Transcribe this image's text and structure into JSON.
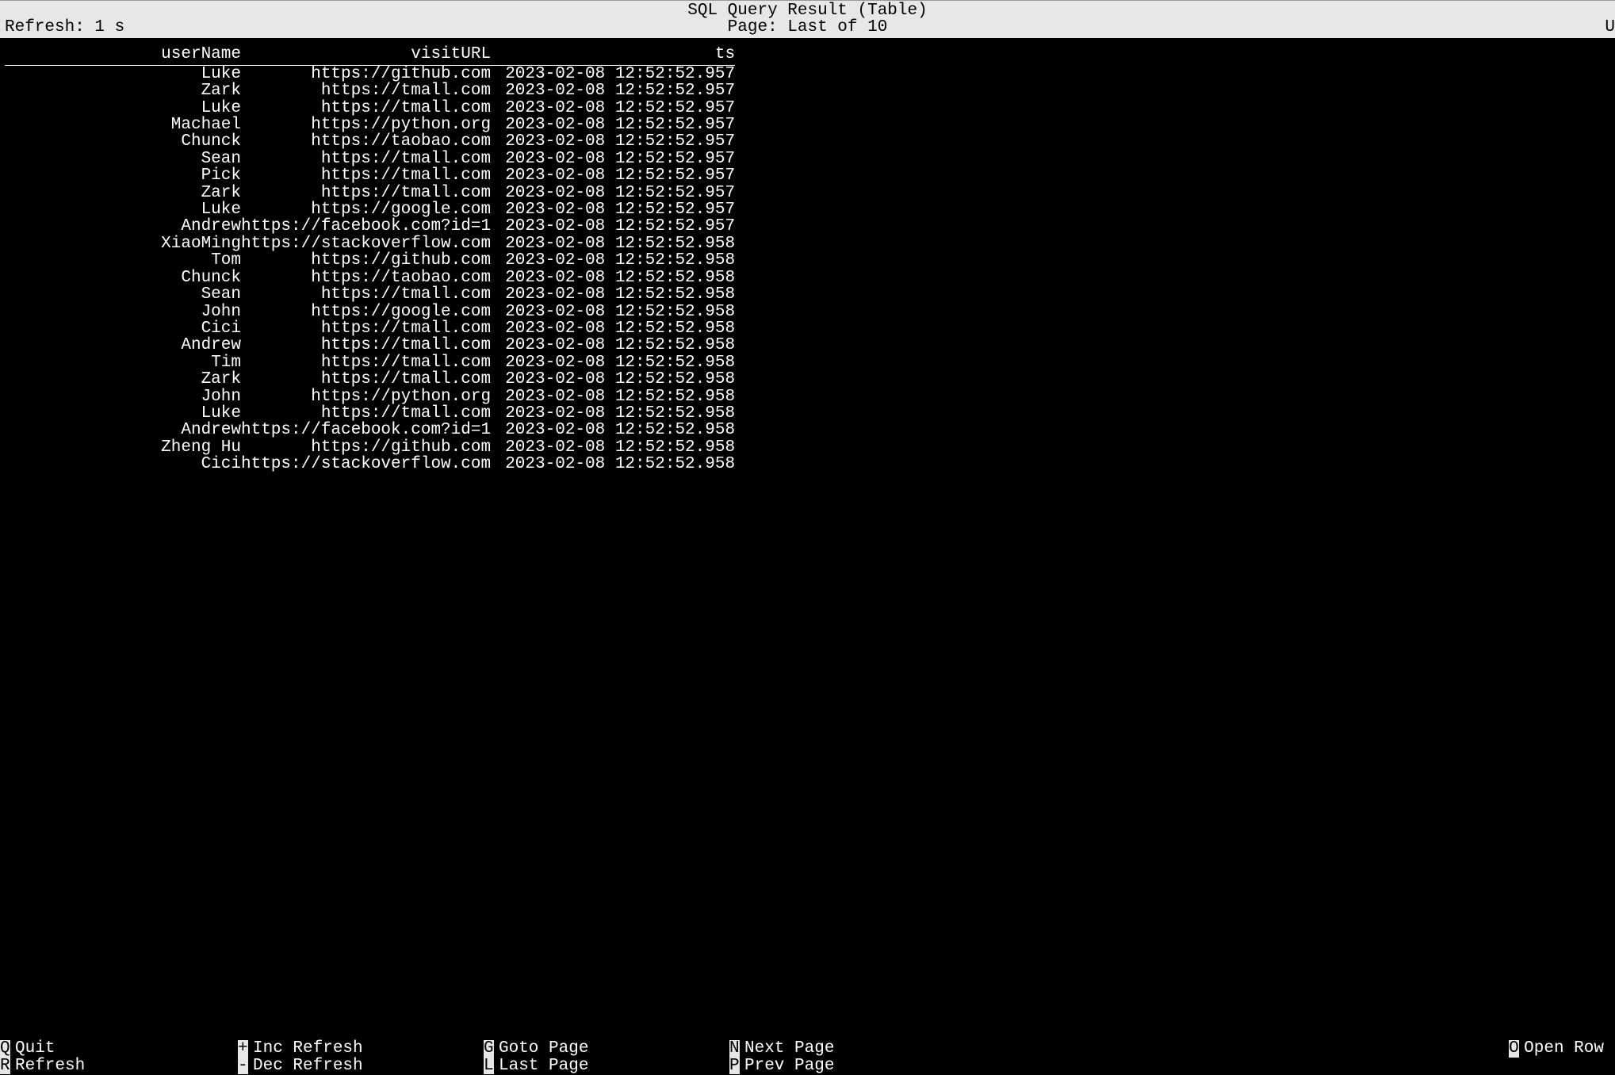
{
  "topbar": {
    "title": "SQL Query Result (Table)",
    "refresh_label": "Refresh: 1 s",
    "page_label": "Page: Last of 10",
    "right_char": "U"
  },
  "table": {
    "headers": {
      "userName": "userName",
      "visitURL": "visitURL",
      "ts": "ts"
    },
    "rows": [
      {
        "userName": "Luke",
        "visitURL": "https://github.com",
        "ts": "2023-02-08 12:52:52.957"
      },
      {
        "userName": "Zark",
        "visitURL": "https://tmall.com",
        "ts": "2023-02-08 12:52:52.957"
      },
      {
        "userName": "Luke",
        "visitURL": "https://tmall.com",
        "ts": "2023-02-08 12:52:52.957"
      },
      {
        "userName": "Machael",
        "visitURL": "https://python.org",
        "ts": "2023-02-08 12:52:52.957"
      },
      {
        "userName": "Chunck",
        "visitURL": "https://taobao.com",
        "ts": "2023-02-08 12:52:52.957"
      },
      {
        "userName": "Sean",
        "visitURL": "https://tmall.com",
        "ts": "2023-02-08 12:52:52.957"
      },
      {
        "userName": "Pick",
        "visitURL": "https://tmall.com",
        "ts": "2023-02-08 12:52:52.957"
      },
      {
        "userName": "Zark",
        "visitURL": "https://tmall.com",
        "ts": "2023-02-08 12:52:52.957"
      },
      {
        "userName": "Luke",
        "visitURL": "https://google.com",
        "ts": "2023-02-08 12:52:52.957"
      },
      {
        "userName": "Andrew",
        "visitURL": "https://facebook.com?id=1",
        "ts": "2023-02-08 12:52:52.957"
      },
      {
        "userName": "XiaoMing",
        "visitURL": "https://stackoverflow.com",
        "ts": "2023-02-08 12:52:52.958"
      },
      {
        "userName": "Tom",
        "visitURL": "https://github.com",
        "ts": "2023-02-08 12:52:52.958"
      },
      {
        "userName": "Chunck",
        "visitURL": "https://taobao.com",
        "ts": "2023-02-08 12:52:52.958"
      },
      {
        "userName": "Sean",
        "visitURL": "https://tmall.com",
        "ts": "2023-02-08 12:52:52.958"
      },
      {
        "userName": "John",
        "visitURL": "https://google.com",
        "ts": "2023-02-08 12:52:52.958"
      },
      {
        "userName": "Cici",
        "visitURL": "https://tmall.com",
        "ts": "2023-02-08 12:52:52.958"
      },
      {
        "userName": "Andrew",
        "visitURL": "https://tmall.com",
        "ts": "2023-02-08 12:52:52.958"
      },
      {
        "userName": "Tim",
        "visitURL": "https://tmall.com",
        "ts": "2023-02-08 12:52:52.958"
      },
      {
        "userName": "Zark",
        "visitURL": "https://tmall.com",
        "ts": "2023-02-08 12:52:52.958"
      },
      {
        "userName": "John",
        "visitURL": "https://python.org",
        "ts": "2023-02-08 12:52:52.958"
      },
      {
        "userName": "Luke",
        "visitURL": "https://tmall.com",
        "ts": "2023-02-08 12:52:52.958"
      },
      {
        "userName": "Andrew",
        "visitURL": "https://facebook.com?id=1",
        "ts": "2023-02-08 12:52:52.958"
      },
      {
        "userName": "Zheng Hu",
        "visitURL": "https://github.com",
        "ts": "2023-02-08 12:52:52.958"
      },
      {
        "userName": "Cici",
        "visitURL": "https://stackoverflow.com",
        "ts": "2023-02-08 12:52:52.958"
      }
    ]
  },
  "footer": {
    "row1": [
      {
        "key": "Q",
        "label": "Quit"
      },
      {
        "key": "+",
        "label": "Inc Refresh"
      },
      {
        "key": "G",
        "label": "Goto Page"
      },
      {
        "key": "N",
        "label": "Next Page"
      },
      {
        "key": "O",
        "label": "Open Row"
      }
    ],
    "row2": [
      {
        "key": "R",
        "label": "Refresh"
      },
      {
        "key": "-",
        "label": "Dec Refresh"
      },
      {
        "key": "L",
        "label": "Last Page"
      },
      {
        "key": "P",
        "label": "Prev Page"
      }
    ]
  }
}
